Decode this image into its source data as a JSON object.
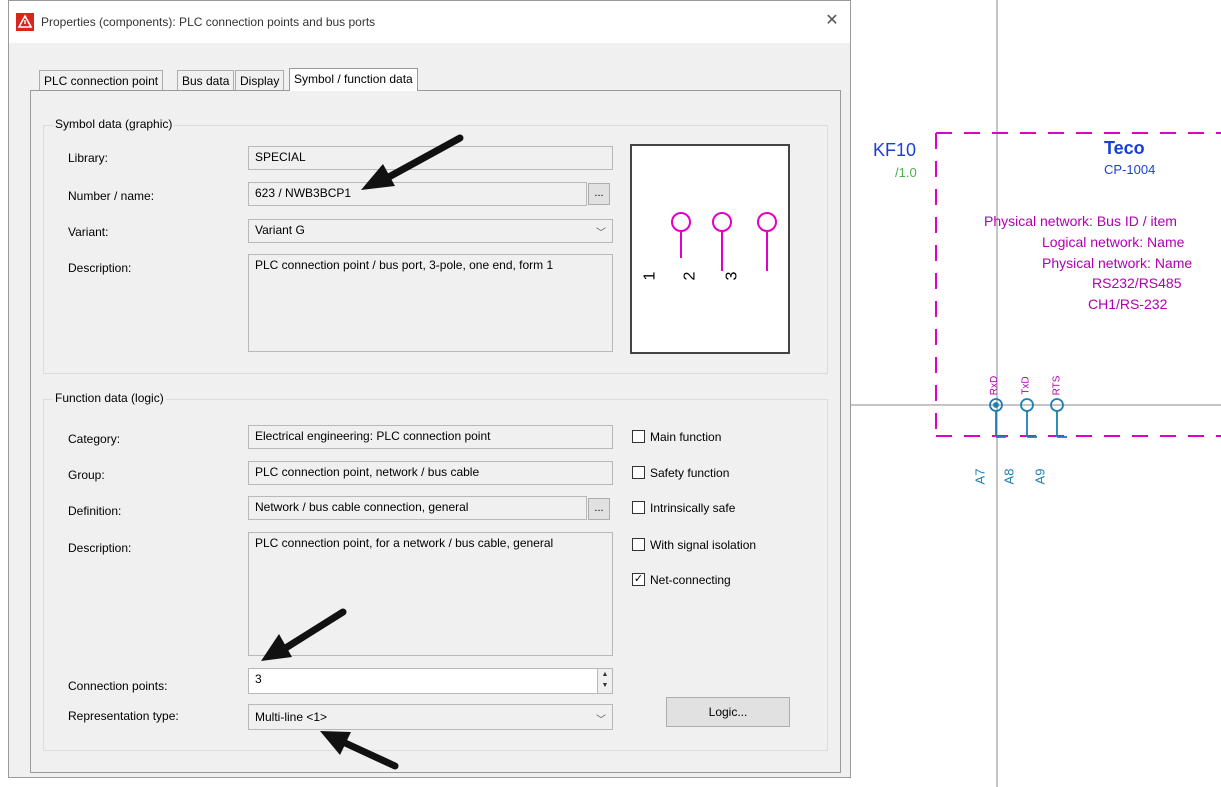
{
  "dialog": {
    "title": "Properties (components): PLC connection points and bus ports",
    "close_glyph": "✕",
    "tabs": [
      "PLC connection point",
      "Bus data",
      "Display",
      "Symbol / function data"
    ],
    "active_tab": "Symbol / function data"
  },
  "symbol_data": {
    "group_title": "Symbol data (graphic)",
    "library": {
      "label": "Library:",
      "value": "SPECIAL"
    },
    "number_name": {
      "label": "Number / name:",
      "value": "623 / NWB3BCP1",
      "button": "..."
    },
    "variant": {
      "label": "Variant:",
      "value": "Variant G"
    },
    "description": {
      "label": "Description:",
      "value": "PLC connection point / bus port, 3-pole, one end, form 1"
    },
    "preview_pins": [
      "1",
      "2",
      "3"
    ],
    "preview_color": "#e000c8"
  },
  "function_data": {
    "group_title": "Function data (logic)",
    "category": {
      "label": "Category:",
      "value": "Electrical engineering: PLC connection point"
    },
    "group": {
      "label": "Group:",
      "value": "PLC connection point, network / bus cable"
    },
    "definition": {
      "label": "Definition:",
      "value": "Network / bus cable connection, general",
      "button": "..."
    },
    "description": {
      "label": "Description:",
      "value": "PLC connection point, for a network / bus cable, general"
    },
    "connection_points": {
      "label": "Connection points:",
      "value": "3"
    },
    "representation_type": {
      "label": "Representation type:",
      "value": "Multi-line <1>"
    },
    "checkboxes": [
      {
        "label": "Main function",
        "checked": false
      },
      {
        "label": "Safety function",
        "checked": false
      },
      {
        "label": "Intrinsically safe",
        "checked": false
      },
      {
        "label": "With signal isolation",
        "checked": false
      },
      {
        "label": "Net-connecting",
        "checked": true
      }
    ],
    "logic_button": "Logic..."
  },
  "schematic": {
    "device_tag": "KF10",
    "device_ref": "/1.0",
    "manufacturer": "Teco",
    "part": "CP-1004",
    "lines": [
      "Physical network: Bus ID / item",
      "Logical network: Name",
      "Physical network: Name",
      "RS232/RS485",
      "CH1/RS-232"
    ],
    "pin_labels": [
      "RxD",
      "TxD",
      "RTS"
    ],
    "connection_labels": [
      "A7",
      "A8",
      "A9"
    ],
    "colors": {
      "box": "#e000c8",
      "tag": "#1a3fd8",
      "ref": "#4caf50",
      "pins": "#1a7fb5",
      "manufacturer": "#1a3fd8"
    }
  }
}
